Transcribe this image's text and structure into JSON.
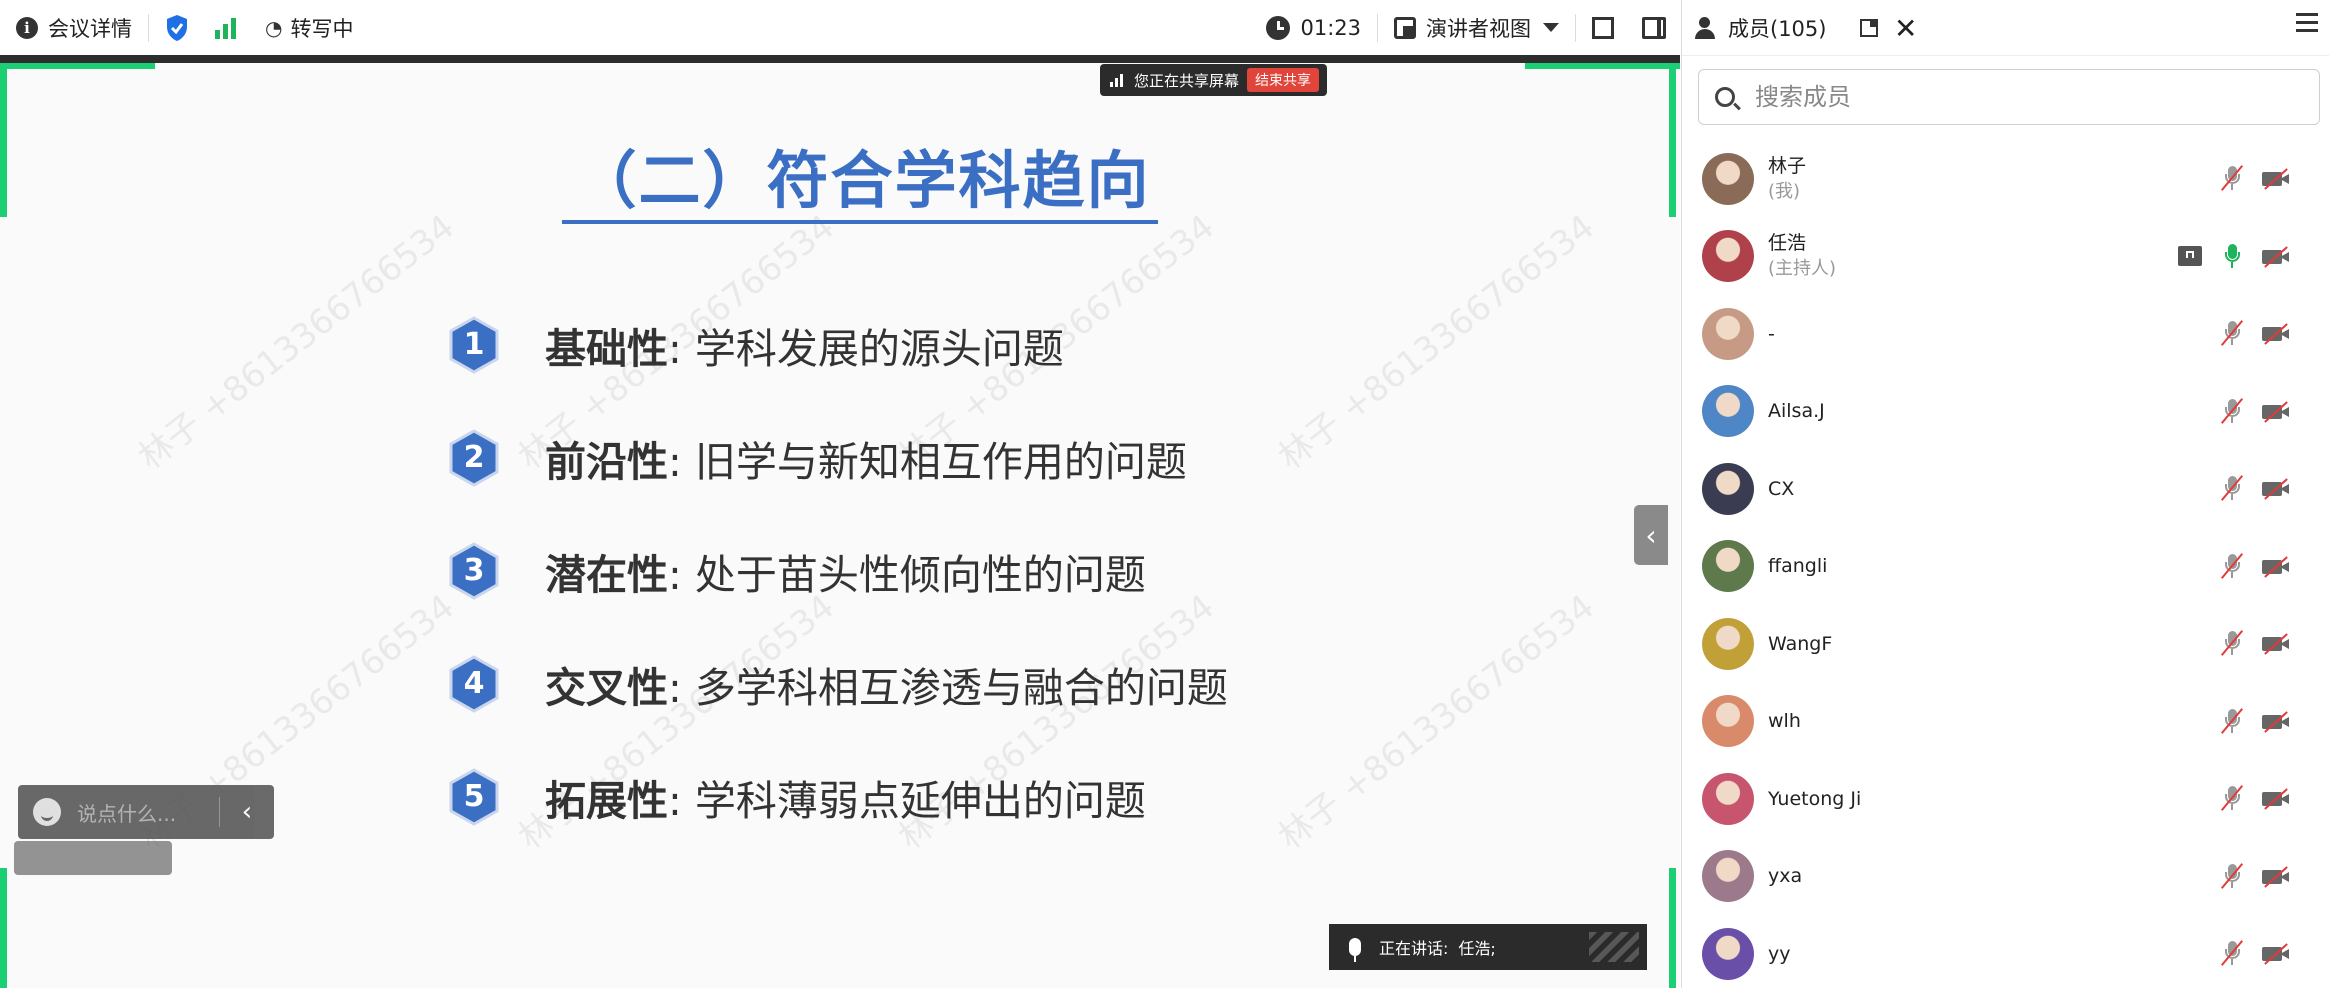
{
  "toolbar": {
    "meeting_details": "会议详情",
    "transcribe": "转写中",
    "timer": "01:23",
    "view_mode": "演讲者视图"
  },
  "share_bar": {
    "text": "您正在共享屏幕",
    "stop": "结束共享"
  },
  "slide": {
    "title": "（二）符合学科趋向",
    "points": [
      {
        "num": "1",
        "key": "基础性",
        "text": ": 学科发展的源头问题"
      },
      {
        "num": "2",
        "key": "前沿性",
        "text": ": 旧学与新知相互作用的问题"
      },
      {
        "num": "3",
        "key": "潜在性",
        "text": ": 处于苗头性倾向性的问题"
      },
      {
        "num": "4",
        "key": "交叉性",
        "text": ": 多学科相互渗透与融合的问题"
      },
      {
        "num": "5",
        "key": "拓展性",
        "text": ": 学科薄弱点延伸出的问题"
      }
    ],
    "badge_color": "#3a6fc4",
    "watermark": "林子 +8613366766534"
  },
  "chat": {
    "placeholder": "说点什么...",
    "collapse": "‹"
  },
  "speaking": {
    "label": "正在讲话:",
    "name": "任浩;"
  },
  "panel": {
    "title": "成员(105)",
    "search_placeholder": "搜索成员",
    "members": [
      {
        "name": "林子",
        "role": "(我)",
        "avatar_color": "#8a6b58",
        "mic": "muted"
      },
      {
        "name": "任浩",
        "role": "(主持人)",
        "avatar_color": "#b0414a",
        "mic": "on",
        "sharing": true
      },
      {
        "name": "-",
        "role": "",
        "avatar_color": "#c79a86",
        "mic": "muted"
      },
      {
        "name": "Ailsa.J",
        "role": "",
        "avatar_color": "#4f86c6",
        "mic": "muted"
      },
      {
        "name": "CX",
        "role": "",
        "avatar_color": "#3a3d52",
        "mic": "muted"
      },
      {
        "name": "ffangli",
        "role": "",
        "avatar_color": "#5e7a4d",
        "mic": "muted"
      },
      {
        "name": "WangF",
        "role": "",
        "avatar_color": "#c2a038",
        "mic": "muted"
      },
      {
        "name": "wlh",
        "role": "",
        "avatar_color": "#d88a6a",
        "mic": "muted"
      },
      {
        "name": "Yuetong Ji",
        "role": "",
        "avatar_color": "#c7556e",
        "mic": "muted"
      },
      {
        "name": "yxa",
        "role": "",
        "avatar_color": "#9c7a8c",
        "mic": "muted"
      },
      {
        "name": "yy",
        "role": "",
        "avatar_color": "#6a4fa8",
        "mic": "muted"
      }
    ]
  },
  "colors": {
    "accent_green": "#1ccf74",
    "title_blue": "#3a6fc4",
    "stop_red": "#e0443a"
  }
}
